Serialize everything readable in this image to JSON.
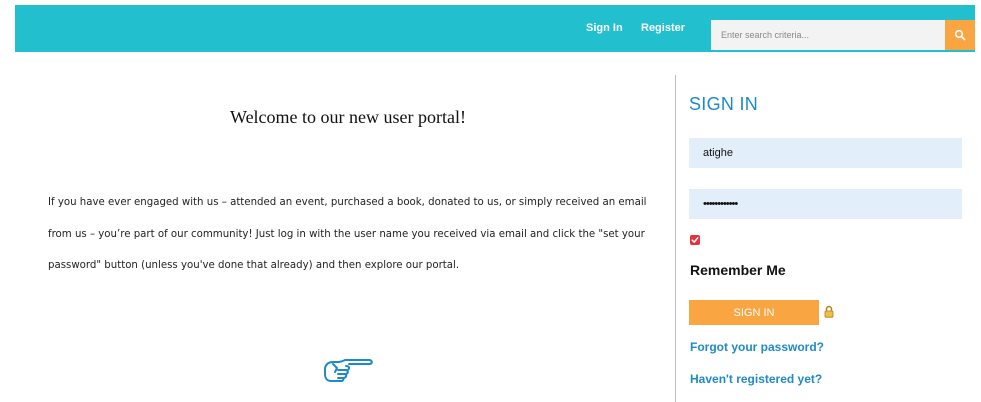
{
  "header": {
    "nav": {
      "sign_in": "Sign In",
      "register": "Register"
    },
    "search": {
      "placeholder": "Enter search criteria...",
      "icon": "search-icon"
    },
    "colors": {
      "bar": "#22bfcf",
      "search_button": "#f8a542"
    }
  },
  "main": {
    "title": "Welcome to our new user portal!",
    "paragraph": "If you have ever engaged with us – attended an event, purchased a book, donated to us, or simply received an email from us – you’re part of our community! Just log in with the user name you received via email and click the \"set your password\" button (unless you've done that already) and then explore our portal.",
    "pointer_icon": "pointing-hand-icon"
  },
  "sidebar": {
    "heading": "SIGN IN",
    "username_value": "atighe",
    "password_value": "••••••••••••",
    "remember_checked": true,
    "remember_label": "Remember Me",
    "submit_label": "SIGN IN",
    "lock_icon": "lock-icon",
    "forgot_link": "Forgot your password?",
    "register_link": "Haven't registered yet?",
    "colors": {
      "heading": "#1f8ac9",
      "field_bg": "#e3eefb",
      "button": "#f8a542",
      "checkbox": "#e0353f"
    }
  }
}
